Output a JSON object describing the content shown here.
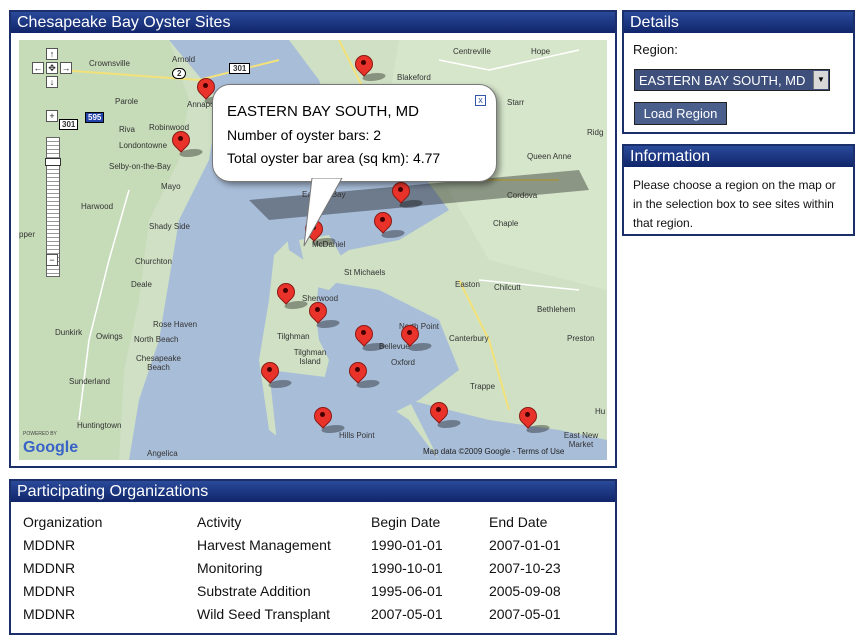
{
  "map_panel": {
    "title": "Chesapeake Bay Oyster Sites",
    "places": [
      {
        "label": "Arnold",
        "name": "place-arnold"
      },
      {
        "label": "Crownsville",
        "name": "place-crownsville"
      },
      {
        "label": "Parole",
        "name": "place-parole"
      },
      {
        "label": "Riva",
        "name": "place-riva"
      },
      {
        "label": "Robinwood",
        "name": "place-robinwood"
      },
      {
        "label": "Londontowne",
        "name": "place-londontowne"
      },
      {
        "label": "Selby-on-the-Bay",
        "name": "place-selby"
      },
      {
        "label": "Mayo",
        "name": "place-mayo"
      },
      {
        "label": "Harwood",
        "name": "place-harwood"
      },
      {
        "label": "Shady Side",
        "name": "place-shady-side"
      },
      {
        "label": "Churchton",
        "name": "place-churchton"
      },
      {
        "label": "Deale",
        "name": "place-deale"
      },
      {
        "label": "Rose Haven",
        "name": "place-rose-haven"
      },
      {
        "label": "Dunkirk",
        "name": "place-dunkirk"
      },
      {
        "label": "Owings",
        "name": "place-owings"
      },
      {
        "label": "North Beach",
        "name": "place-north-beach"
      },
      {
        "label": "Chesapeake Beach",
        "name": "place-chesapeake-beach"
      },
      {
        "label": "Sunderland",
        "name": "place-sunderland"
      },
      {
        "label": "Huntingtown",
        "name": "place-huntingtown"
      },
      {
        "label": "Angelica",
        "name": "place-angelica"
      },
      {
        "label": "Centreville",
        "name": "place-centreville"
      },
      {
        "label": "Hope",
        "name": "place-hope"
      },
      {
        "label": "Starr",
        "name": "place-starr"
      },
      {
        "label": "Blakeford",
        "name": "place-blakeford"
      },
      {
        "label": "Queen Anne",
        "name": "place-queen-anne"
      },
      {
        "label": "Cordova",
        "name": "place-cordova"
      },
      {
        "label": "Chaple",
        "name": "place-chaple"
      },
      {
        "label": "Eastern Bay",
        "name": "place-eastern-bay"
      },
      {
        "label": "McDaniel",
        "name": "place-mcdaniel"
      },
      {
        "label": "St Michaels",
        "name": "place-st-michaels"
      },
      {
        "label": "Easton",
        "name": "place-easton"
      },
      {
        "label": "Chilcutt",
        "name": "place-chilcutt"
      },
      {
        "label": "Sherwood",
        "name": "place-sherwood"
      },
      {
        "label": "Tilghman",
        "name": "place-tilghman"
      },
      {
        "label": "Tilghman Island",
        "name": "place-tilghman-island"
      },
      {
        "label": "North Point",
        "name": "place-north-point"
      },
      {
        "label": "Bellevue",
        "name": "place-bellevue"
      },
      {
        "label": "Oxford",
        "name": "place-oxford"
      },
      {
        "label": "Canterbury",
        "name": "place-canterbury"
      },
      {
        "label": "Bethlehem",
        "name": "place-bethlehem"
      },
      {
        "label": "Preston",
        "name": "place-preston"
      },
      {
        "label": "Trappe",
        "name": "place-trappe"
      },
      {
        "label": "Hills Point",
        "name": "place-hills-point"
      },
      {
        "label": "East New Market",
        "name": "place-east-new-market"
      },
      {
        "label": "Annapolis",
        "name": "place-annapolis"
      },
      {
        "label": "Ridg",
        "name": "place-ridg"
      },
      {
        "label": "Hu",
        "name": "place-hu"
      },
      {
        "label": "pper",
        "name": "place-upper"
      }
    ],
    "route_shields": [
      "2",
      "301",
      "595",
      "301"
    ],
    "bubble": {
      "title": "EASTERN BAY SOUTH, MD",
      "line1": "Number of oyster bars: 2",
      "line2": "Total oyster bar area (sq km): 4.77",
      "close": "x"
    },
    "powered_by": "POWERED BY",
    "logo": "Google",
    "copyright": "Map data ©2009 Google - Terms of Use"
  },
  "details": {
    "title": "Details",
    "region_label": "Region:",
    "region_value": "EASTERN BAY SOUTH, MD",
    "load_button": "Load Region"
  },
  "information": {
    "title": "Information",
    "text": "Please choose a region on the map or in the selection box to see sites within that region."
  },
  "organizations": {
    "title": "Participating Organizations",
    "headers": [
      "Organization",
      "Activity",
      "Begin Date",
      "End Date"
    ],
    "rows": [
      [
        "MDDNR",
        "Harvest Management",
        "1990-01-01",
        "2007-01-01"
      ],
      [
        "MDDNR",
        "Monitoring",
        "1990-10-01",
        "2007-10-23"
      ],
      [
        "MDDNR",
        "Substrate Addition",
        "1995-06-01",
        "2005-09-08"
      ],
      [
        "MDDNR",
        "Wild Seed Transplant",
        "2007-05-01",
        "2007-05-01"
      ]
    ]
  },
  "colors": {
    "header": "#1b2f6b",
    "water": "#a8bdd8",
    "land": "#cfe0c4",
    "marker": "#e8322a"
  }
}
